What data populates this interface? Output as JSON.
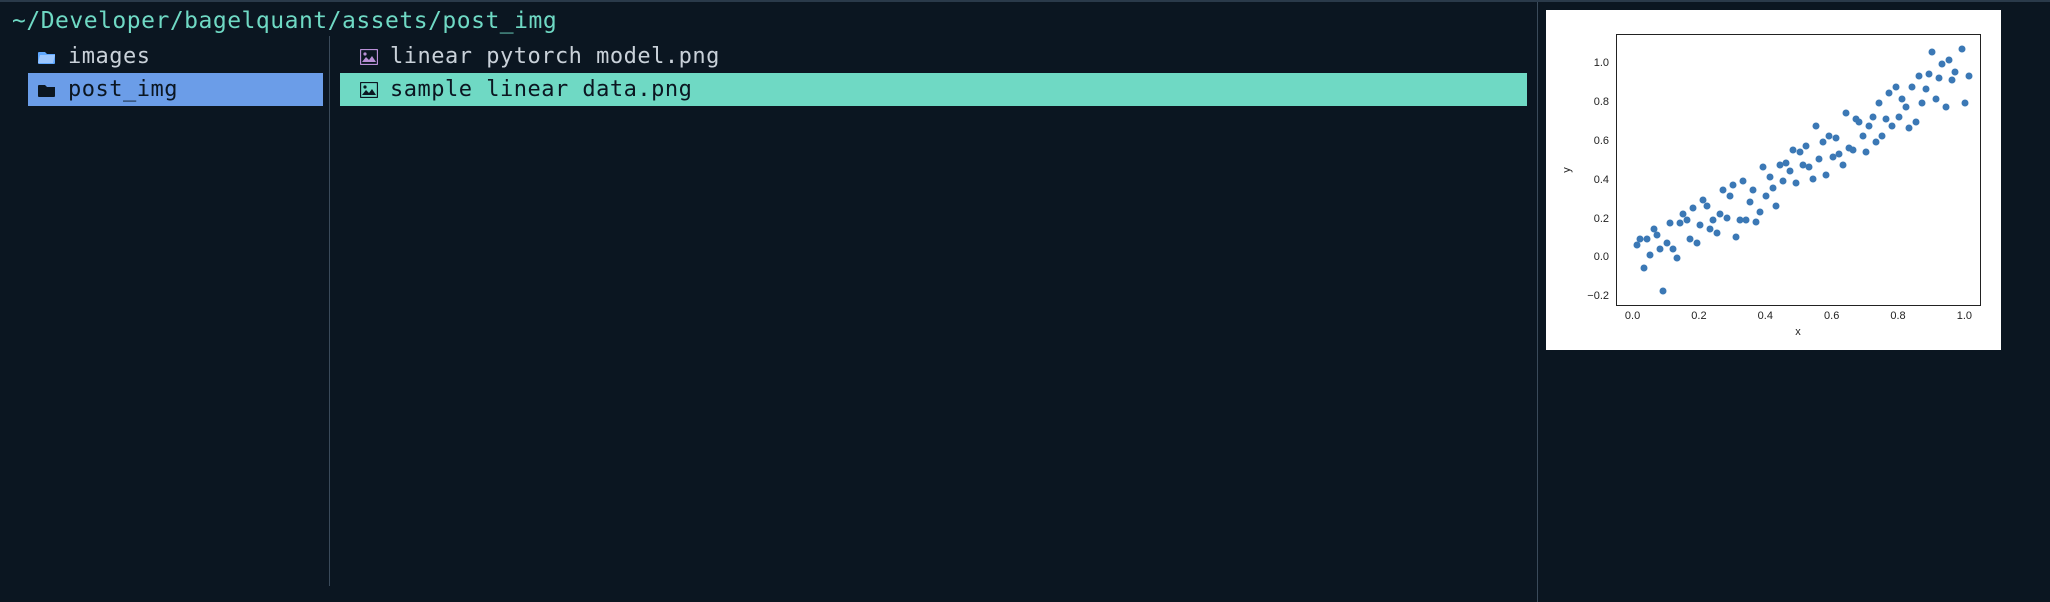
{
  "path": "~/Developer/bagelquant/assets/post_img",
  "left_pane": {
    "items": [
      {
        "name": "images",
        "kind": "folder-open",
        "selected": false
      },
      {
        "name": "post_img",
        "kind": "folder-closed",
        "selected": true
      }
    ]
  },
  "right_pane": {
    "items": [
      {
        "name": "linear pytorch model.png",
        "kind": "image",
        "selected": false
      },
      {
        "name": "sample linear data.png",
        "kind": "image",
        "selected": true
      }
    ]
  },
  "chart_data": {
    "type": "scatter",
    "xlabel": "x",
    "ylabel": "y",
    "xlim": [
      -0.05,
      1.05
    ],
    "ylim": [
      -0.25,
      1.15
    ],
    "xticks": [
      0.0,
      0.2,
      0.4,
      0.6,
      0.8,
      1.0
    ],
    "yticks": [
      -0.2,
      0.0,
      0.2,
      0.4,
      0.6,
      0.8,
      1.0
    ],
    "x": [
      0.01,
      0.02,
      0.03,
      0.04,
      0.05,
      0.07,
      0.08,
      0.09,
      0.1,
      0.11,
      0.13,
      0.14,
      0.15,
      0.17,
      0.18,
      0.19,
      0.2,
      0.21,
      0.23,
      0.24,
      0.25,
      0.26,
      0.28,
      0.29,
      0.3,
      0.31,
      0.32,
      0.34,
      0.35,
      0.36,
      0.38,
      0.39,
      0.4,
      0.41,
      0.43,
      0.44,
      0.45,
      0.46,
      0.48,
      0.49,
      0.5,
      0.51,
      0.53,
      0.54,
      0.55,
      0.56,
      0.58,
      0.59,
      0.6,
      0.61,
      0.62,
      0.64,
      0.65,
      0.66,
      0.67,
      0.69,
      0.7,
      0.71,
      0.72,
      0.74,
      0.75,
      0.76,
      0.78,
      0.79,
      0.8,
      0.81,
      0.82,
      0.84,
      0.85,
      0.86,
      0.87,
      0.89,
      0.9,
      0.91,
      0.92,
      0.94,
      0.95,
      0.96,
      0.97,
      0.99,
      1.0,
      1.01,
      0.06,
      0.12,
      0.16,
      0.22,
      0.27,
      0.33,
      0.37,
      0.42,
      0.47,
      0.52,
      0.57,
      0.63,
      0.68,
      0.73,
      0.77,
      0.83,
      0.88,
      0.93
    ],
    "y": [
      0.07,
      0.1,
      -0.05,
      0.1,
      0.02,
      0.12,
      0.05,
      -0.17,
      0.08,
      0.18,
      0.0,
      0.18,
      0.23,
      0.1,
      0.26,
      0.08,
      0.17,
      0.3,
      0.15,
      0.2,
      0.13,
      0.23,
      0.21,
      0.32,
      0.38,
      0.11,
      0.2,
      0.2,
      0.29,
      0.35,
      0.24,
      0.47,
      0.32,
      0.42,
      0.27,
      0.48,
      0.4,
      0.49,
      0.56,
      0.39,
      0.55,
      0.48,
      0.47,
      0.41,
      0.68,
      0.51,
      0.43,
      0.63,
      0.52,
      0.62,
      0.54,
      0.75,
      0.57,
      0.56,
      0.72,
      0.63,
      0.55,
      0.68,
      0.73,
      0.8,
      0.63,
      0.72,
      0.68,
      0.88,
      0.73,
      0.82,
      0.78,
      0.88,
      0.7,
      0.94,
      0.8,
      0.95,
      1.06,
      0.82,
      0.93,
      0.78,
      1.02,
      0.92,
      0.96,
      1.08,
      0.8,
      0.94,
      0.15,
      0.05,
      0.2,
      0.27,
      0.35,
      0.4,
      0.19,
      0.36,
      0.45,
      0.58,
      0.6,
      0.48,
      0.7,
      0.6,
      0.85,
      0.67,
      0.87,
      1.0
    ]
  }
}
